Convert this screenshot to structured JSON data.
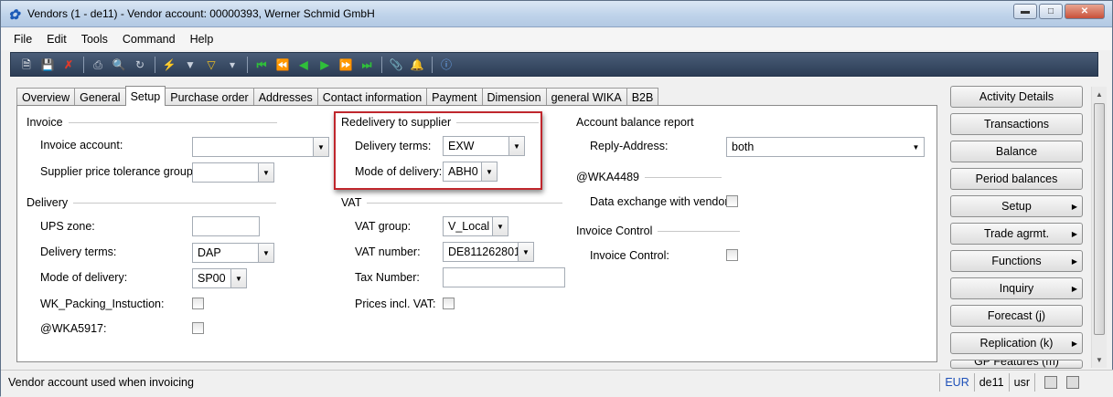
{
  "window": {
    "title": "Vendors (1 - de11) - Vendor account: 00000393, Werner Schmid GmbH",
    "app_icon": "dynamics-ax-icon",
    "controls": [
      "minimize",
      "maximize",
      "close"
    ]
  },
  "menu": [
    "File",
    "Edit",
    "Tools",
    "Command",
    "Help"
  ],
  "toolbar": {
    "icons": [
      "new-icon",
      "save-icon",
      "delete-icon",
      "print-icon",
      "print-preview-icon",
      "refresh-icon",
      "filter-by-selection-icon",
      "filter-icon",
      "advanced-filter-icon",
      "remove-filter-icon",
      "first-record-icon",
      "previous-page-icon",
      "previous-record-icon",
      "next-record-icon",
      "next-page-icon",
      "last-record-icon",
      "document-handling-icon",
      "alert-icon",
      "help-icon"
    ]
  },
  "tabs": [
    {
      "label": "Overview"
    },
    {
      "label": "General"
    },
    {
      "label": "Setup",
      "active": true
    },
    {
      "label": "Purchase order"
    },
    {
      "label": "Addresses"
    },
    {
      "label": "Contact information"
    },
    {
      "label": "Payment"
    },
    {
      "label": "Dimension"
    },
    {
      "label": "general WIKA"
    },
    {
      "label": "B2B"
    }
  ],
  "invoice": {
    "title": "Invoice",
    "invoice_account_label": "Invoice account:",
    "invoice_account_value": "",
    "price_tolerance_label": "Supplier price tolerance group:",
    "price_tolerance_value": ""
  },
  "delivery": {
    "title": "Delivery",
    "ups_zone_label": "UPS zone:",
    "ups_zone_value": "",
    "terms_label": "Delivery terms:",
    "terms_value": "DAP",
    "mode_label": "Mode of delivery:",
    "mode_value": "SP00",
    "packing_label": "WK_Packing_Instuction:",
    "packing_checked": false,
    "wka5917_label": "@WKA5917:",
    "wka5917_checked": false
  },
  "redelivery": {
    "title": "Redelivery to supplier",
    "terms_label": "Delivery terms:",
    "terms_value": "EXW",
    "mode_label": "Mode of delivery:",
    "mode_value": "ABH0"
  },
  "vat": {
    "title": "VAT",
    "group_label": "VAT group:",
    "group_value": "V_Local",
    "number_label": "VAT number:",
    "number_value": "DE811262801",
    "tax_number_label": "Tax Number:",
    "tax_number_value": "",
    "prices_incl_label": "Prices incl. VAT:",
    "prices_incl_checked": false
  },
  "account_balance": {
    "title": "Account balance report",
    "reply_label": "Reply-Address:",
    "reply_value": "both"
  },
  "wka4489": {
    "title": "@WKA4489",
    "data_exchange_label": "Data exchange with vendor:",
    "data_exchange_checked": false
  },
  "invoice_control": {
    "title": "Invoice Control",
    "label": "Invoice Control:",
    "checked": false
  },
  "side_buttons": [
    {
      "label": "Activity Details",
      "submenu": false
    },
    {
      "label": "Transactions",
      "submenu": false
    },
    {
      "label": "Balance",
      "submenu": false
    },
    {
      "label": "Period balances",
      "submenu": false
    },
    {
      "label": "Setup",
      "submenu": true
    },
    {
      "label": "Trade agrmt.",
      "submenu": true
    },
    {
      "label": "Functions",
      "submenu": true
    },
    {
      "label": "Inquiry",
      "submenu": true
    },
    {
      "label": "Forecast (j)",
      "submenu": false
    },
    {
      "label": "Replication (k)",
      "submenu": true
    },
    {
      "label": "GP Features (m)",
      "submenu": true
    }
  ],
  "status": {
    "text": "Vendor account used when invoicing",
    "currency": "EUR",
    "company": "de11",
    "layer": "usr"
  },
  "colors": {
    "highlight_border": "#c0272d",
    "toolbar_bg": "#34465f",
    "titlebar_bg": "#c4d6ec"
  }
}
